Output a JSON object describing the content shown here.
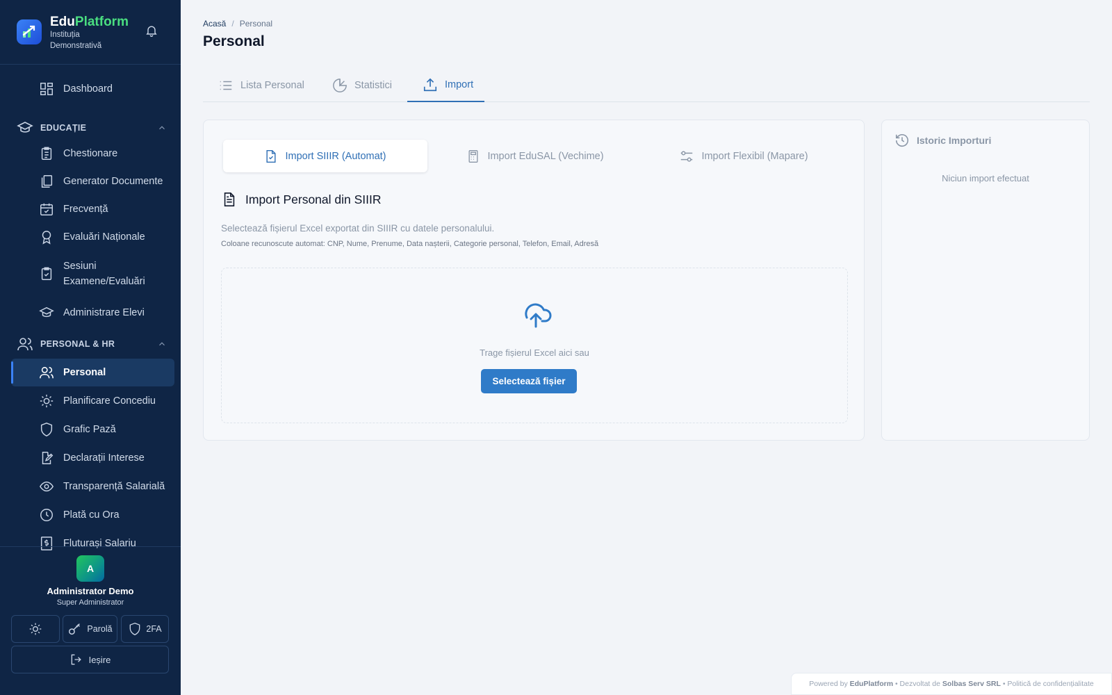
{
  "brand": {
    "name_part1": "Edu",
    "name_part2": "Platform",
    "institution": "Instituția Demonstrativă"
  },
  "sidebar": {
    "dashboard": "Dashboard",
    "sections": [
      {
        "label": "EDUCAȚIE"
      },
      {
        "label": "PERSONAL & HR"
      }
    ],
    "education_items": [
      {
        "label": "Chestionare",
        "icon": "clipboard-icon"
      },
      {
        "label": "Generator Documente",
        "icon": "documents-icon"
      },
      {
        "label": "Frecvență",
        "icon": "calendar-check-icon"
      },
      {
        "label": "Evaluări Naționale",
        "icon": "award-icon"
      },
      {
        "label": "Sesiuni Examene/Evaluări",
        "icon": "clipboard-check-icon"
      },
      {
        "label": "Administrare Elevi",
        "icon": "graduation-cap-icon"
      }
    ],
    "hr_items": [
      {
        "label": "Personal",
        "icon": "users-icon",
        "active": true
      },
      {
        "label": "Planificare Concediu",
        "icon": "sun-icon"
      },
      {
        "label": "Grafic Pază",
        "icon": "shield-icon"
      },
      {
        "label": "Declarații Interese",
        "icon": "edit-document-icon"
      },
      {
        "label": "Transparență Salarială",
        "icon": "eye-icon"
      },
      {
        "label": "Plată cu Ora",
        "icon": "clock-icon"
      },
      {
        "label": "Fluturași Salariu",
        "icon": "receipt-icon"
      }
    ]
  },
  "user": {
    "initial": "A",
    "name": "Administrator Demo",
    "role": "Super Administrator",
    "password_label": "Parolă",
    "twofa_label": "2FA",
    "logout_label": "Ieșire"
  },
  "breadcrumb": {
    "home": "Acasă",
    "separator": "/",
    "current": "Personal"
  },
  "page_title": "Personal",
  "tabs": [
    {
      "label": "Lista Personal",
      "icon": "list-icon"
    },
    {
      "label": "Statistici",
      "icon": "pie-chart-icon"
    },
    {
      "label": "Import",
      "icon": "upload-icon",
      "active": true
    }
  ],
  "import_card": {
    "sub_tabs": [
      {
        "label": "Import SIIIR (Automat)",
        "icon": "file-check-icon",
        "active": true
      },
      {
        "label": "Import EduSAL (Vechime)",
        "icon": "calculator-icon"
      },
      {
        "label": "Import Flexibil (Mapare)",
        "icon": "sliders-icon"
      }
    ],
    "title": "Import Personal din SIIIR",
    "description": "Selectează fișierul Excel exportat din SIIIR cu datele personalului.",
    "columns_hint": "Coloane recunoscute automat: CNP, Nume, Prenume, Data nașterii, Categorie personal, Telefon, Email, Adresă",
    "drop_text": "Trage fișierul Excel aici sau",
    "select_button": "Selectează fișier"
  },
  "history": {
    "title": "Istoric Importuri",
    "empty": "Niciun import efectuat"
  },
  "footer": {
    "powered": "Powered by",
    "platform": "EduPlatform",
    "dev_by": "• Dezvoltat de",
    "company": "Solbas Serv SRL",
    "privacy": "• Politică de confidențialitate"
  },
  "colors": {
    "sidebar_bg": "#0f2545",
    "accent": "#2f7bc8",
    "brand_green": "#4ade80"
  }
}
